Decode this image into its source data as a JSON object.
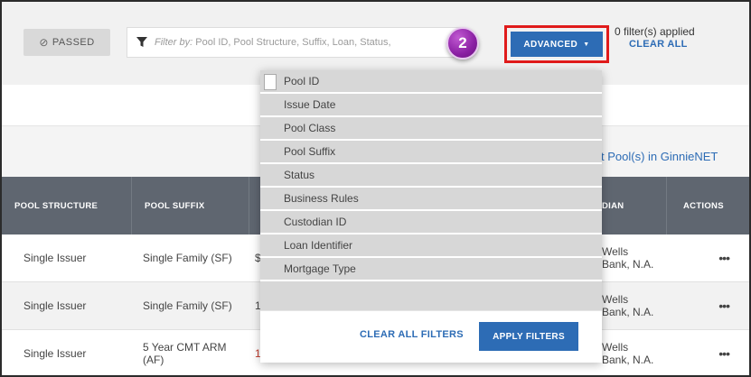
{
  "toolbar": {
    "passed_label": "PASSED",
    "filter_placeholder_prefix": "Filter by:",
    "filter_placeholder_rest": "Pool ID, Pool Structure, Suffix, Loan, Status,",
    "step_number": "2",
    "advanced_label": "ADVANCED",
    "filters_applied": "0 filter(s) applied",
    "clear_all": "CLEAR ALL"
  },
  "ginnie_link": "t Pool(s) in GinnieNET",
  "table": {
    "headers": [
      "POOL STRUCTURE",
      "POOL SUFFIX",
      "",
      "DIAN",
      "ACTIONS"
    ],
    "rows": [
      {
        "structure": "Single Issuer",
        "suffix": "Single Family (SF)",
        "col3": "$",
        "custodian_l1": "Wells",
        "custodian_l2": "Bank, N.A.",
        "actions": "•••"
      },
      {
        "structure": "Single Issuer",
        "suffix": "Single Family (SF)",
        "col3": "1",
        "custodian_l1": "Wells",
        "custodian_l2": "Bank, N.A.",
        "actions": "•••"
      },
      {
        "structure": "Single Issuer",
        "suffix_l1": "5 Year CMT ARM",
        "suffix_l2": "(AF)",
        "col3": "1",
        "custodian_l1": "Wells",
        "custodian_l2": "Bank, N.A.",
        "actions": "•••"
      }
    ]
  },
  "dropdown": {
    "items": [
      "Pool ID",
      "Issue Date",
      "Pool Class",
      "Pool Suffix",
      "Status",
      "Business Rules",
      "Custodian ID",
      "Loan Identifier",
      "Mortgage Type"
    ],
    "clear_all_filters": "CLEAR ALL FILTERS",
    "apply_filters": "APPLY FILTERS"
  },
  "colors": {
    "accent_blue": "#2d6cb5",
    "highlight_red": "#e01b1b",
    "badge_purple": "#8a1fa3",
    "header_gray": "#5f6670"
  },
  "icons": [
    "passed-icon",
    "filter-icon",
    "caret-down-icon",
    "ellipsis-icon"
  ]
}
